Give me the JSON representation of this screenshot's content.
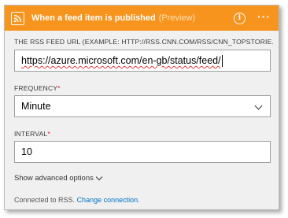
{
  "header": {
    "title": "When a feed item is published",
    "preview": "(Preview)",
    "more": "···",
    "info_glyph": "i",
    "color": "#f7941d"
  },
  "feed_url": {
    "label": "THE RSS FEED URL (EXAMPLE: HTTP://RSS.CNN.COM/RSS/CNN_TOPSTORIE...",
    "value": "https://azure.microsoft.com/en-gb/status/feed/"
  },
  "frequency": {
    "label": "FREQUENCY",
    "required_mark": "*",
    "value": "Minute"
  },
  "interval": {
    "label": "INTERVAL",
    "required_mark": "*",
    "value": "10"
  },
  "advanced_options": "Show advanced options",
  "footer": {
    "text": "Connected to RSS.",
    "link": "Change connection."
  },
  "icons": [
    "rss-icon",
    "info-icon",
    "more-options-icon",
    "chevron-down-icon"
  ]
}
